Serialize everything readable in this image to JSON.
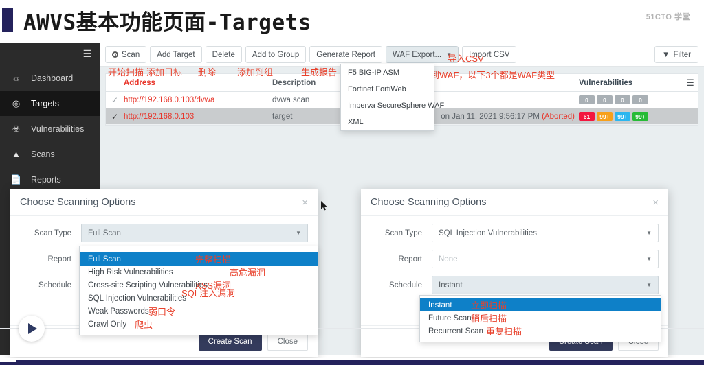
{
  "slide": {
    "title": "AWVS基本功能页面-Targets",
    "watermark": "51CTO 学堂"
  },
  "sidebar": {
    "collapse_icon": "hamburger-icon",
    "items": [
      {
        "label": "Dashboard",
        "icon": "speedometer-icon",
        "active": false
      },
      {
        "label": "Targets",
        "icon": "target-icon",
        "active": true
      },
      {
        "label": "Vulnerabilities",
        "icon": "bug-icon",
        "active": false
      },
      {
        "label": "Scans",
        "icon": "chart-icon",
        "active": false
      },
      {
        "label": "Reports",
        "icon": "document-icon",
        "active": false
      }
    ]
  },
  "toolbar": {
    "buttons": [
      {
        "label": "Scan",
        "annotation": "开始扫描"
      },
      {
        "label": "Add Target",
        "annotation": "添加目标"
      },
      {
        "label": "Delete",
        "annotation": "删除"
      },
      {
        "label": "Add to Group",
        "annotation": "添加到组"
      },
      {
        "label": "Generate Report",
        "annotation": "生成报告"
      },
      {
        "label": "WAF Export...",
        "annotation": ""
      },
      {
        "label": "Import CSV",
        "annotation": "导入CSV"
      }
    ],
    "filter_label": "Filter",
    "filter_icon": "funnel-icon",
    "waf_annotation": "将结果导出到WAF，以下3个都是WAF类型"
  },
  "waf_menu": {
    "items": [
      "F5 BIG-IP ASM",
      "Fortinet FortiWeb",
      "Imperva SecureSphere WAF",
      "XML"
    ]
  },
  "table": {
    "headers": {
      "address": "Address",
      "description": "Description",
      "vulnerabilities": "Vulnerabilities"
    },
    "menu_icon": "list-menu-icon",
    "rows": [
      {
        "checked": false,
        "address": "http://192.168.0.103/dvwa",
        "description": "dvwa scan",
        "status": "",
        "status_suffix": "",
        "chips": [
          {
            "text": "0",
            "color": "#a9b0b5"
          },
          {
            "text": "0",
            "color": "#a9b0b5"
          },
          {
            "text": "0",
            "color": "#a9b0b5"
          },
          {
            "text": "0",
            "color": "#a9b0b5"
          }
        ]
      },
      {
        "checked": true,
        "address": "http://192.168.0.103",
        "description": "target",
        "status": "on Jan 11, 2021 9:56:17 PM",
        "status_suffix": "(Aborted)",
        "chips": [
          {
            "text": "61",
            "color": "#f3173f"
          },
          {
            "text": "99+",
            "color": "#f7a01b"
          },
          {
            "text": "99+",
            "color": "#2bb6ef"
          },
          {
            "text": "99+",
            "color": "#27bb36"
          }
        ]
      }
    ]
  },
  "modal_left": {
    "title": "Choose Scanning Options",
    "close_icon": "close-icon",
    "fields": {
      "scan_type_label": "Scan Type",
      "scan_type_value": "Full Scan",
      "report_label": "Report",
      "report_value": "",
      "schedule_label": "Schedule",
      "schedule_value": ""
    },
    "scan_type_options": [
      {
        "label": "Full Scan",
        "annotation": "完整扫描",
        "highlight": true
      },
      {
        "label": "High Risk Vulnerabilities",
        "annotation": "高危漏洞",
        "highlight": false
      },
      {
        "label": "Cross-site Scripting Vulnerabilities",
        "annotation": "XSS漏洞",
        "highlight": false
      },
      {
        "label": "SQL Injection Vulnerabilities",
        "annotation": "SQL注入漏洞",
        "highlight": false
      },
      {
        "label": "Weak Passwords",
        "annotation": "弱口令",
        "highlight": false
      },
      {
        "label": "Crawl Only",
        "annotation": "爬虫",
        "highlight": false
      }
    ],
    "create_label": "Create Scan",
    "close_label": "Close"
  },
  "modal_right": {
    "title": "Choose Scanning Options",
    "close_icon": "close-icon",
    "fields": {
      "scan_type_label": "Scan Type",
      "scan_type_value": "SQL Injection Vulnerabilities",
      "report_label": "Report",
      "report_placeholder": "None",
      "schedule_label": "Schedule",
      "schedule_value": "Instant"
    },
    "schedule_options": [
      {
        "label": "Instant",
        "annotation": "立即扫描",
        "highlight": true
      },
      {
        "label": "Future Scan",
        "annotation": "稍后扫描",
        "highlight": false
      },
      {
        "label": "Recurrent Scan",
        "annotation": "重复扫描",
        "highlight": false
      }
    ],
    "create_label": "Create Scan",
    "close_label": "Close"
  },
  "player": {
    "play_icon": "play-icon"
  },
  "colors": {
    "accent": "#24225c",
    "annotation": "#e8412c",
    "highlight": "#0e80c8",
    "primary_button": "#343b5c",
    "sidebar": "#2b2b2b"
  }
}
